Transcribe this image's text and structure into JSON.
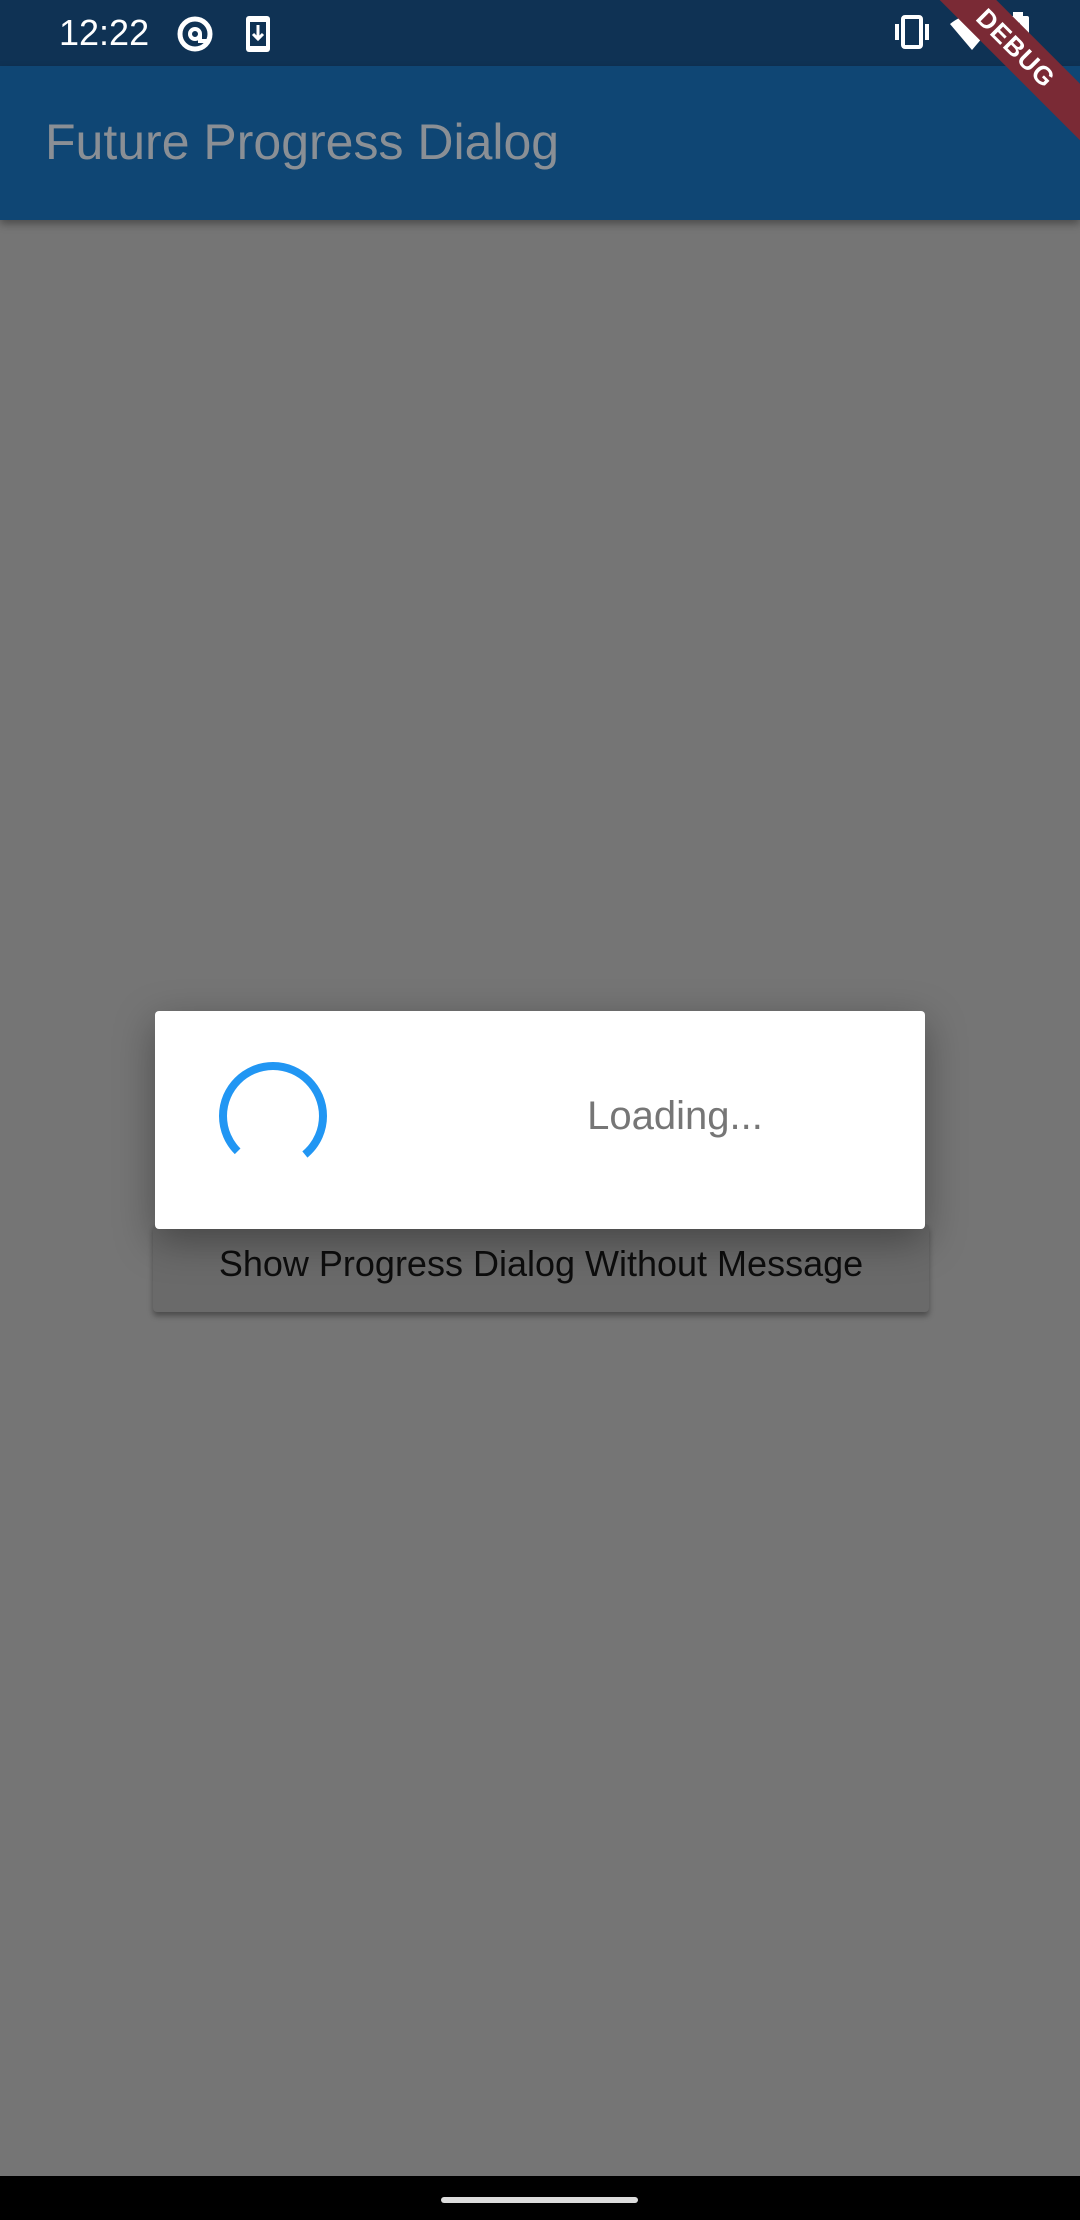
{
  "status_bar": {
    "time": "12:22",
    "icons": [
      "at-sign-icon",
      "download-icon",
      "vibrate-icon",
      "wifi-icon",
      "battery-charging-icon"
    ]
  },
  "app_bar": {
    "title": "Future Progress Dialog"
  },
  "debug_banner": {
    "label": "DEBUG"
  },
  "main": {
    "button_label": "Show Progress Dialog Without Message"
  },
  "dialog": {
    "message": "Loading...",
    "spinner_color": "#2196f3"
  },
  "colors": {
    "status_bar": "#0f3254",
    "app_bar": "#0f4674",
    "scrim_background": "#757575",
    "dialog_background": "#ffffff",
    "accent": "#2196f3",
    "debug_banner": "#7a2a35"
  }
}
